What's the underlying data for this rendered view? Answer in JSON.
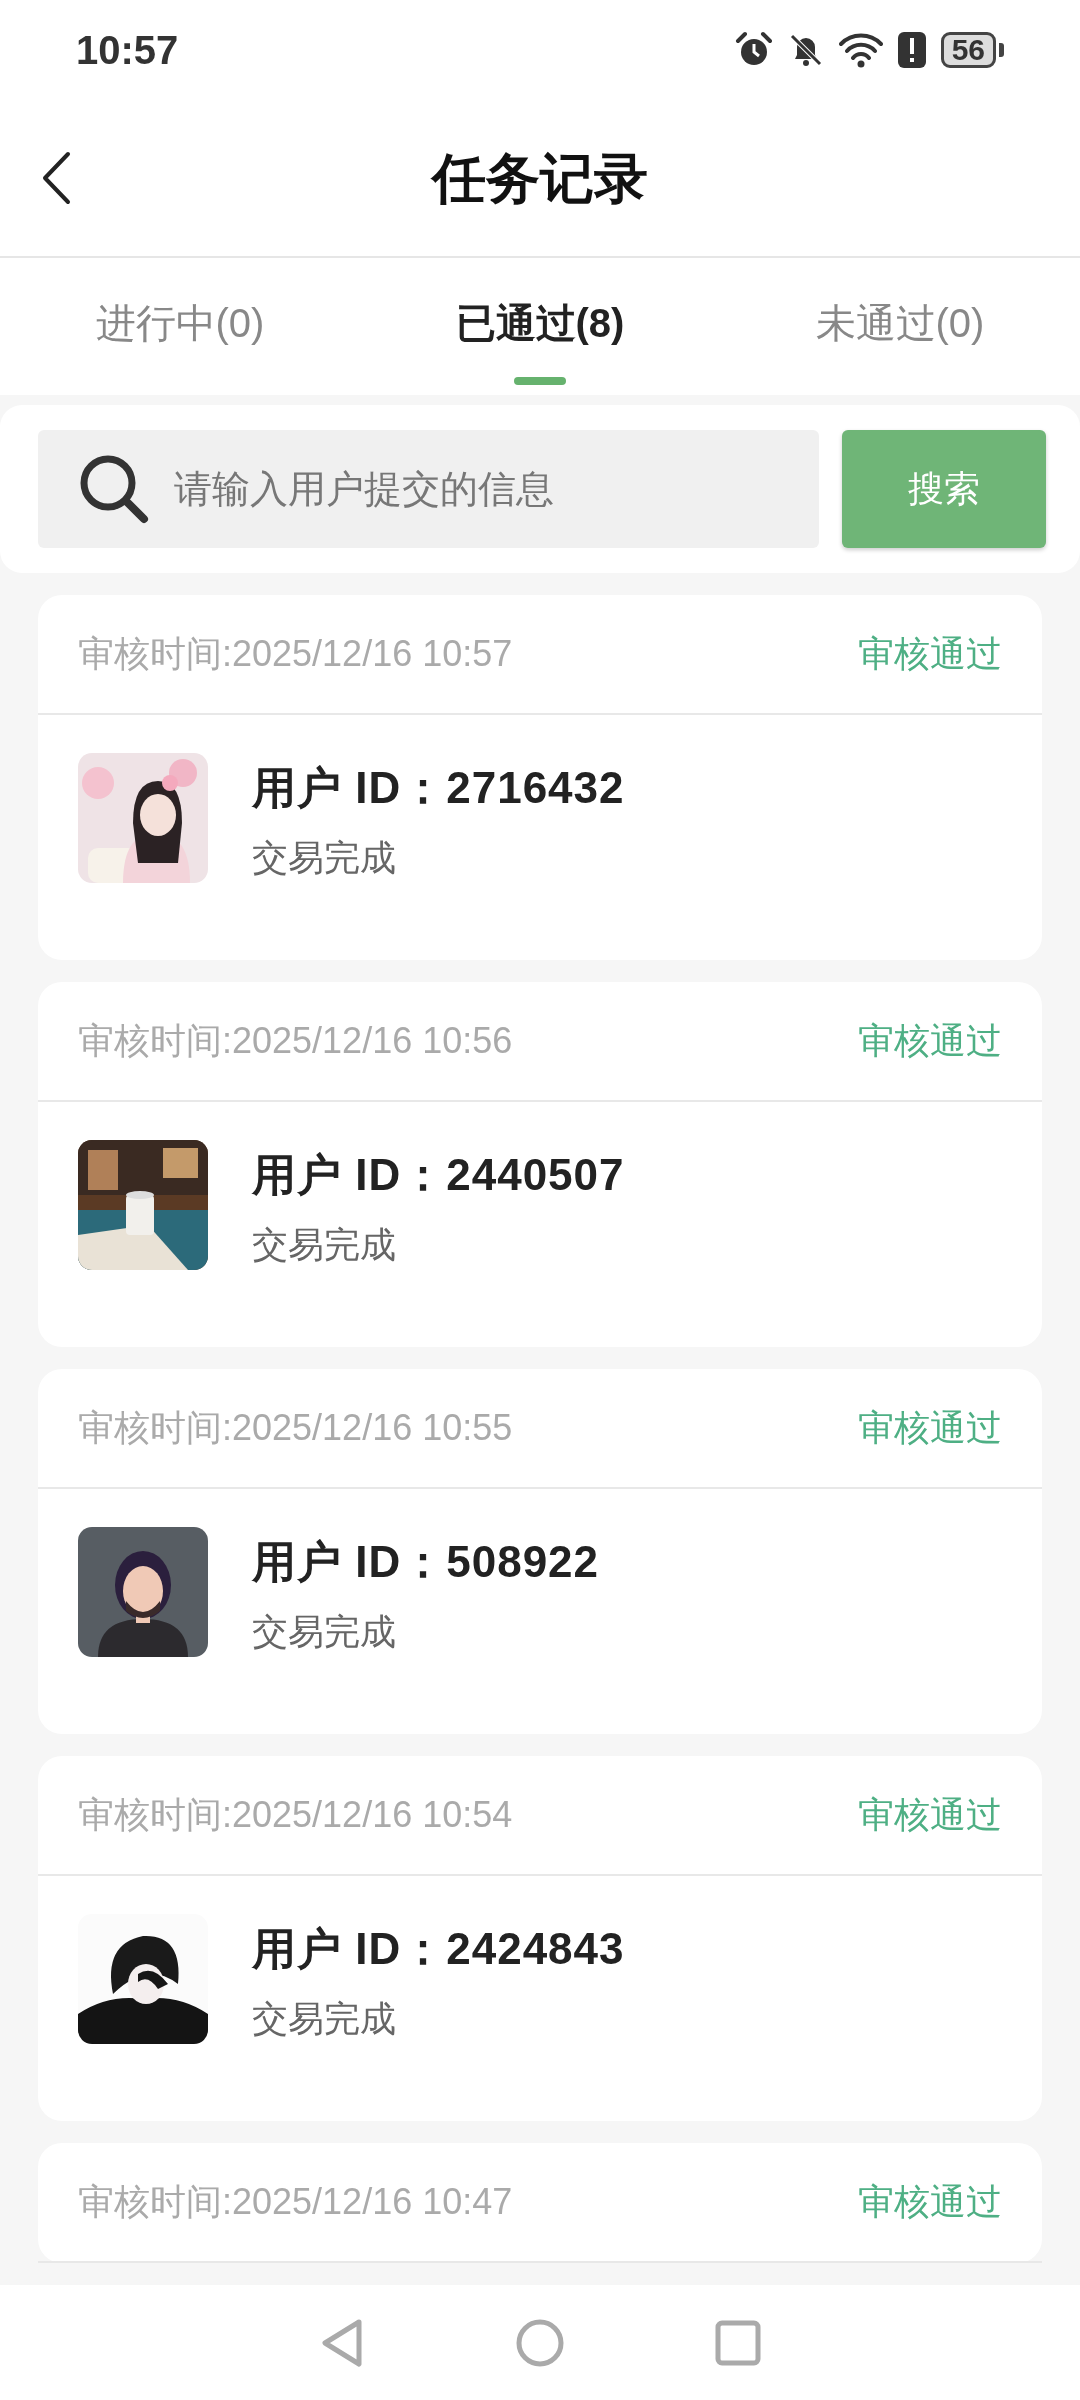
{
  "status_bar": {
    "time": "10:57",
    "battery": "56"
  },
  "header": {
    "title": "任务记录"
  },
  "tabs": [
    {
      "label": "进行中(0)",
      "selected": false
    },
    {
      "label": "已通过(8)",
      "selected": true
    },
    {
      "label": "未通过(0)",
      "selected": false
    }
  ],
  "search": {
    "placeholder": "请输入用户提交的信息",
    "button": "搜索"
  },
  "records": [
    {
      "time": "审核时间:2025/12/16 10:57",
      "status": "审核通过",
      "user_id": "用户 ID：2716432",
      "result": "交易完成"
    },
    {
      "time": "审核时间:2025/12/16 10:56",
      "status": "审核通过",
      "user_id": "用户 ID：2440507",
      "result": "交易完成"
    },
    {
      "time": "审核时间:2025/12/16 10:55",
      "status": "审核通过",
      "user_id": "用户 ID：508922",
      "result": "交易完成"
    },
    {
      "time": "审核时间:2025/12/16 10:54",
      "status": "审核通过",
      "user_id": "用户 ID：2424843",
      "result": "交易完成"
    },
    {
      "time": "审核时间:2025/12/16 10:47",
      "status": "审核通过"
    }
  ]
}
